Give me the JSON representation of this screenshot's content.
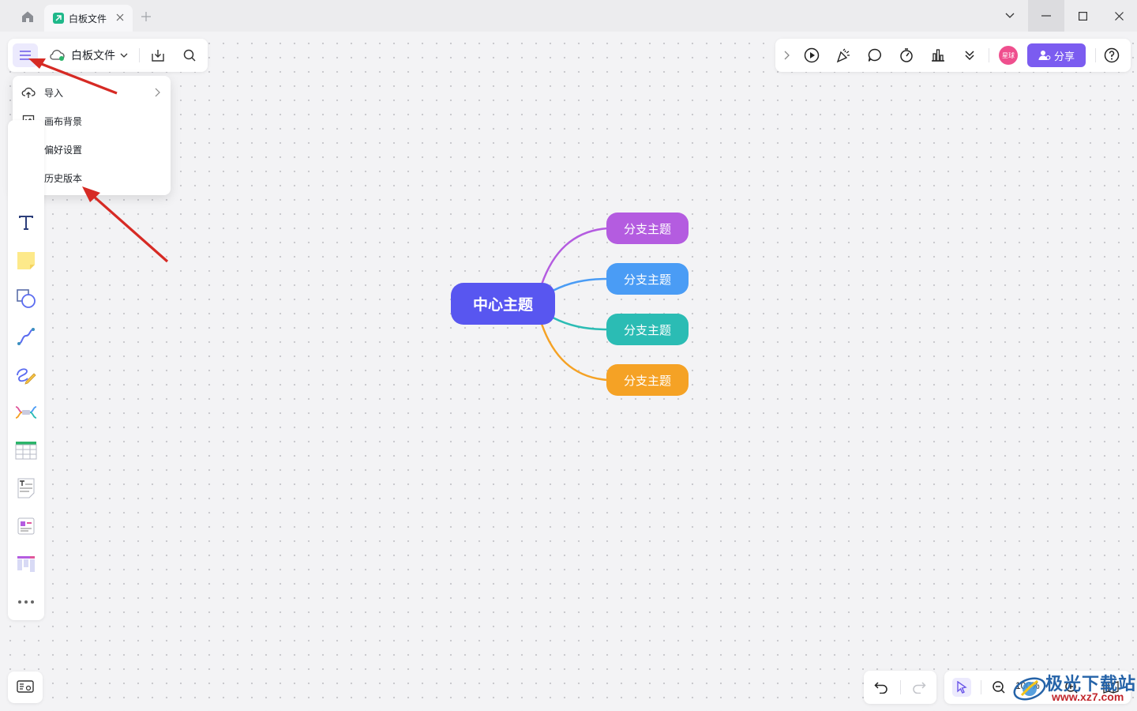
{
  "window": {
    "tab_title": "白板文件"
  },
  "toolbar": {
    "file_name": "白板文件"
  },
  "menu": {
    "items": [
      {
        "label": "导入",
        "icon": "cloud-upload-icon",
        "has_submenu": true
      },
      {
        "label": "画布背景",
        "icon": "canvas-background-icon",
        "has_submenu": false
      },
      {
        "label": "偏好设置",
        "icon": "sliders-icon",
        "has_submenu": false
      },
      {
        "label": "历史版本",
        "icon": "history-icon",
        "has_submenu": false
      }
    ]
  },
  "left_tools": [
    "text-tool-icon",
    "sticky-note-icon",
    "shape-icon",
    "connector-icon",
    "pen-icon",
    "mind-map-icon",
    "table-icon",
    "text-document-icon",
    "card-icon",
    "kanban-icon",
    "more-icon"
  ],
  "top_right": {
    "avatar_text": "星球",
    "share_label": "分享"
  },
  "zoom": {
    "level": "100%"
  },
  "mindmap": {
    "center": "中心主题",
    "branches": [
      {
        "label": "分支主题",
        "color": "#b45ce0"
      },
      {
        "label": "分支主题",
        "color": "#4a9cf5"
      },
      {
        "label": "分支主题",
        "color": "#2bbcb4"
      },
      {
        "label": "分支主题",
        "color": "#f5a225"
      }
    ]
  },
  "watermark": {
    "title": "极光下载站",
    "url": "www.xz7.com"
  },
  "colors": {
    "accent": "#7b5cf0",
    "center_node": "#5856f0",
    "annotation_arrow": "#d62a24"
  }
}
